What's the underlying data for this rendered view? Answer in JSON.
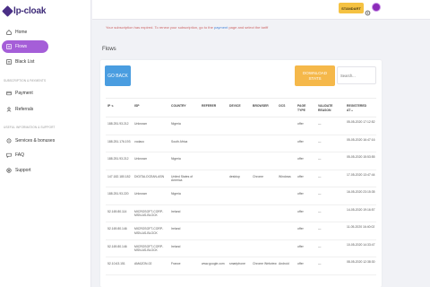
{
  "app": {
    "logo_text": "lp-cloak"
  },
  "sidebar": {
    "items": [
      {
        "label": "Home",
        "icon": "home-icon"
      },
      {
        "label": "Flows",
        "icon": "flows-icon"
      },
      {
        "label": "Black List",
        "icon": "list-icon"
      },
      {
        "label": "Payment",
        "icon": "payment-icon"
      },
      {
        "label": "Referrals",
        "icon": "referrals-icon"
      },
      {
        "label": "Services & bonuses",
        "icon": "services-icon"
      },
      {
        "label": "FAQ",
        "icon": "faq-icon"
      },
      {
        "label": "Support",
        "icon": "support-icon"
      }
    ],
    "sections": [
      "SUBSCRIPTION & PAYMENTS",
      "USEFUL INFORMATION & SUPPORT"
    ]
  },
  "topbar": {
    "notice_text": "Your subscription has expired. To renew your subscription, go to the",
    "notice_link": "payment",
    "notice_tail": "page and select the tariff",
    "upgrade_label": "STANDART"
  },
  "page": {
    "title": "Flows"
  },
  "toolbar": {
    "go_back": "GO BACK",
    "download_stats": "DOWNLOAD\nSTATS",
    "search_placeholder": "Search..."
  },
  "table": {
    "headers": [
      "IP",
      "ISP",
      "COUNTRY",
      "REFERER",
      "DEVICE",
      "BROWSER",
      "OCS",
      "PAGE TYPE",
      "VALIDATE REASON",
      "REGISTERED AT"
    ],
    "rows": [
      [
        "188.251.93.212",
        "Unknown",
        "Nigeria",
        "",
        "",
        "",
        "",
        "offer",
        "—",
        "05-05-2020 17:12:52"
      ],
      [
        "188.251.176.193",
        "vodaco",
        "South Africa",
        "",
        "",
        "",
        "",
        "offer",
        "—",
        "05-05-2020 16:47:16"
      ],
      [
        "188.251.93.212",
        "Unknown",
        "Nigeria",
        "",
        "",
        "",
        "",
        "offer",
        "—",
        "05-05-2020 15:53:55"
      ],
      [
        "147.182.180.182",
        "DIGITALOCEAN-ASN",
        "United States of America",
        "",
        "desktop",
        "Chrome",
        "Windows",
        "offer",
        "—",
        "17-05-2020 13:47:44"
      ],
      [
        "188.251.93.220",
        "Unknown",
        "Nigeria",
        "",
        "",
        "",
        "",
        "offer",
        "—",
        "16-05-2020 23:15:35"
      ],
      [
        "52.169.80.114",
        "MICROSOFT-CORP-MSN-AS-BLOCK",
        "Ireland",
        "",
        "",
        "",
        "",
        "offer",
        "—",
        "14-05-2020 19:16:57"
      ],
      [
        "52.169.80.146",
        "MICROSOFT-CORP-MSN-AS-BLOCK",
        "Ireland",
        "",
        "",
        "",
        "",
        "offer",
        "—",
        "11-05-2020 16:40:02"
      ],
      [
        "52.169.80.146",
        "MICROSOFT-CORP-MSN-AS-BLOCK",
        "Ireland",
        "",
        "",
        "",
        "",
        "offer",
        "—",
        "10-05-2020 14:33:47"
      ],
      [
        "52.10.63.151",
        "AMAZON-02",
        "France",
        "www.google.com",
        "smartphone",
        "Chrome Webview",
        "Android",
        "offer",
        "—",
        "08-05-2020 12:38:30"
      ]
    ]
  },
  "colors": {
    "accent": "#a55ed8",
    "go_back": "#4a9de0",
    "download": "#f5b84a",
    "upgrade": "#f5c242"
  }
}
